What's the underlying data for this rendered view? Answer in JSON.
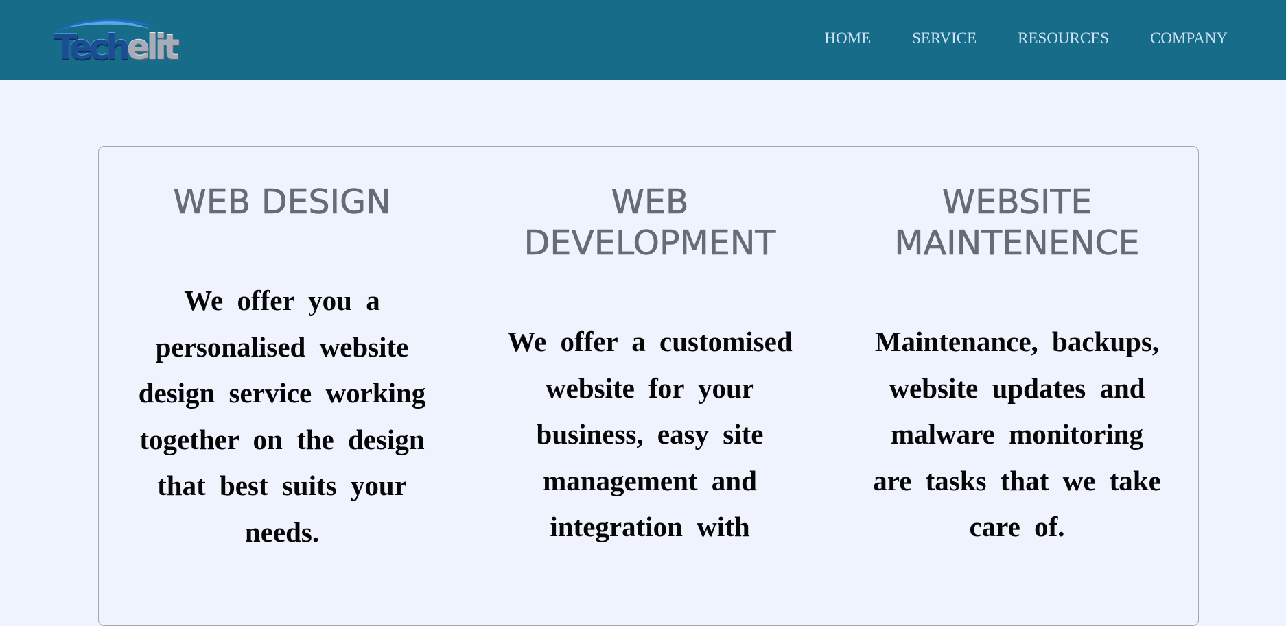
{
  "header": {
    "logo": {
      "part1": "Tech",
      "part2": "elit",
      "colors": {
        "primary": "#1b4d92",
        "secondary": "#a7adb8"
      }
    },
    "nav": {
      "home": "HOME",
      "service": "SERVICE",
      "resources": "RESOURCES",
      "company": "COMPANY"
    },
    "background_color": "#176d89"
  },
  "services": [
    {
      "title": "WEB DESIGN",
      "description": "We offer you a personalised website design service working together on the design that best suits your needs."
    },
    {
      "title": "WEB DEVELOPMENT",
      "description": "We offer a customised website for your business, easy site management and integration with"
    },
    {
      "title": "WEBSITE MAINTENENCE",
      "description": "Maintenance, backups, website updates and malware monitoring are tasks that we take care of."
    }
  ],
  "page_background_color": "#eef3fe"
}
